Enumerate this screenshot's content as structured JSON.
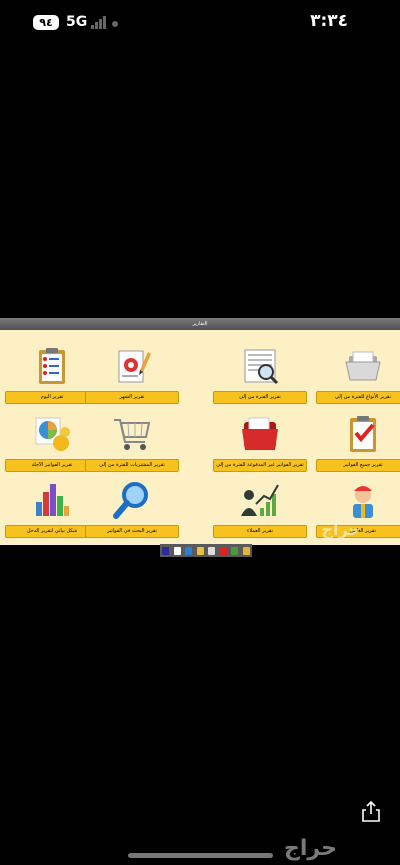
{
  "status_bar": {
    "time": "٣:٣٤",
    "battery": "٩٤",
    "network": "5G"
  },
  "window": {
    "title": "التقارير"
  },
  "tiles": [
    {
      "label": "تقرير اليوم",
      "icon": "clipboard-checklist-icon"
    },
    {
      "label": "تقرير الشهر",
      "icon": "document-pen-icon"
    },
    {
      "label": "تقرير الفترة من إلى",
      "icon": "document-magnifier-icon"
    },
    {
      "label": "تقرير الأنواع للفترة من إلى",
      "icon": "open-folder-icon"
    },
    {
      "label": "تقرير الفواتير الآجلة",
      "icon": "pie-chart-icon"
    },
    {
      "label": "تقرير المشتريات للفترة من إلى",
      "icon": "shopping-cart-icon"
    },
    {
      "label": "تقرير الفواتير غير المدفوعة للفترة من إلى",
      "icon": "red-folder-icon"
    },
    {
      "label": "تقرير جميع الفواتير",
      "icon": "clipboard-check-icon"
    },
    {
      "label": "شكل بياني لتقرير الدخل",
      "icon": "bar-chart-icon"
    },
    {
      "label": "تقرير البحث في الفواتير",
      "icon": "search-magnifier-icon"
    },
    {
      "label": "تقرير العملاء",
      "icon": "customers-growth-icon"
    },
    {
      "label": "تقرير العامل",
      "icon": "worker-icon"
    }
  ],
  "watermark": "حراج",
  "footer": {
    "brand": "حراج"
  },
  "colors": {
    "app_background": "#fdf0c4",
    "tile_label": "#f7c21e"
  }
}
